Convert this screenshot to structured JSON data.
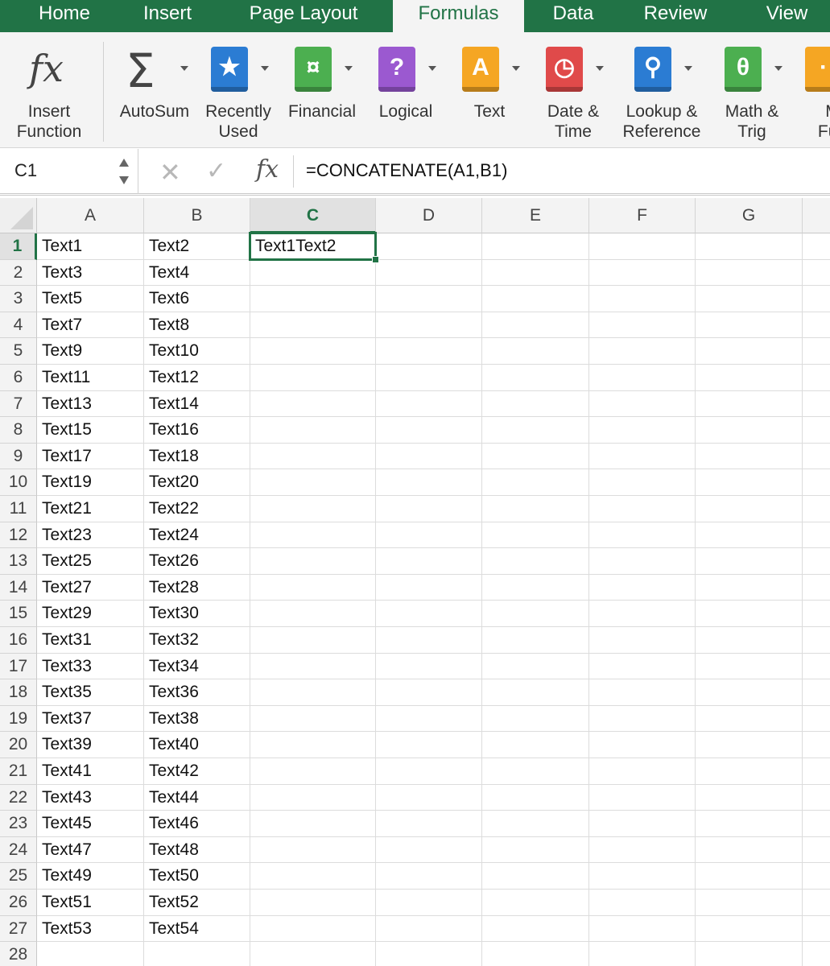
{
  "tabs": [
    "Home",
    "Insert",
    "Page Layout",
    "Formulas",
    "Data",
    "Review",
    "View"
  ],
  "active_tab": "Formulas",
  "ribbon": {
    "buttons": [
      {
        "label": "Insert\nFunction",
        "icon": "fx-icon",
        "color": ""
      },
      {
        "label": "AutoSum",
        "icon": "sigma-icon",
        "color": ""
      },
      {
        "label": "Recently\nUsed",
        "icon": "star-icon",
        "color": "#2b7cd3",
        "glyph": "★"
      },
      {
        "label": "Financial",
        "icon": "coins-icon",
        "color": "#4caf50",
        "glyph": "¤"
      },
      {
        "label": "Logical",
        "icon": "question-icon",
        "color": "#9b59d0",
        "glyph": "?"
      },
      {
        "label": "Text",
        "icon": "text-a-icon",
        "color": "#f5a623",
        "glyph": "A"
      },
      {
        "label": "Date &\nTime",
        "icon": "clock-icon",
        "color": "#e04a4a",
        "glyph": "◷"
      },
      {
        "label": "Lookup &\nReference",
        "icon": "magnifier-icon",
        "color": "#2b7cd3",
        "glyph": "⚲"
      },
      {
        "label": "Math &\nTrig",
        "icon": "theta-icon",
        "color": "#4caf50",
        "glyph": "θ"
      },
      {
        "label": "M\nFun",
        "icon": "more-functions-icon",
        "color": "#f5a623",
        "glyph": "·"
      }
    ]
  },
  "formula_bar": {
    "name_box": "C1",
    "fx_label": "fx",
    "formula": "=CONCATENATE(A1,B1)"
  },
  "columns": [
    "A",
    "B",
    "C",
    "D",
    "E",
    "F",
    "G"
  ],
  "selected_column": "C",
  "selected_row": 1,
  "rows": [
    [
      "Text1",
      "Text2",
      "Text1Text2"
    ],
    [
      "Text3",
      "Text4",
      ""
    ],
    [
      "Text5",
      "Text6",
      ""
    ],
    [
      "Text7",
      "Text8",
      ""
    ],
    [
      "Text9",
      "Text10",
      ""
    ],
    [
      "Text11",
      "Text12",
      ""
    ],
    [
      "Text13",
      "Text14",
      ""
    ],
    [
      "Text15",
      "Text16",
      ""
    ],
    [
      "Text17",
      "Text18",
      ""
    ],
    [
      "Text19",
      "Text20",
      ""
    ],
    [
      "Text21",
      "Text22",
      ""
    ],
    [
      "Text23",
      "Text24",
      ""
    ],
    [
      "Text25",
      "Text26",
      ""
    ],
    [
      "Text27",
      "Text28",
      ""
    ],
    [
      "Text29",
      "Text30",
      ""
    ],
    [
      "Text31",
      "Text32",
      ""
    ],
    [
      "Text33",
      "Text34",
      ""
    ],
    [
      "Text35",
      "Text36",
      ""
    ],
    [
      "Text37",
      "Text38",
      ""
    ],
    [
      "Text39",
      "Text40",
      ""
    ],
    [
      "Text41",
      "Text42",
      ""
    ],
    [
      "Text43",
      "Text44",
      ""
    ],
    [
      "Text45",
      "Text46",
      ""
    ],
    [
      "Text47",
      "Text48",
      ""
    ],
    [
      "Text49",
      "Text50",
      ""
    ],
    [
      "Text51",
      "Text52",
      ""
    ],
    [
      "Text53",
      "Text54",
      ""
    ],
    [
      "",
      "",
      ""
    ]
  ],
  "colors": {
    "accent": "#217346"
  }
}
